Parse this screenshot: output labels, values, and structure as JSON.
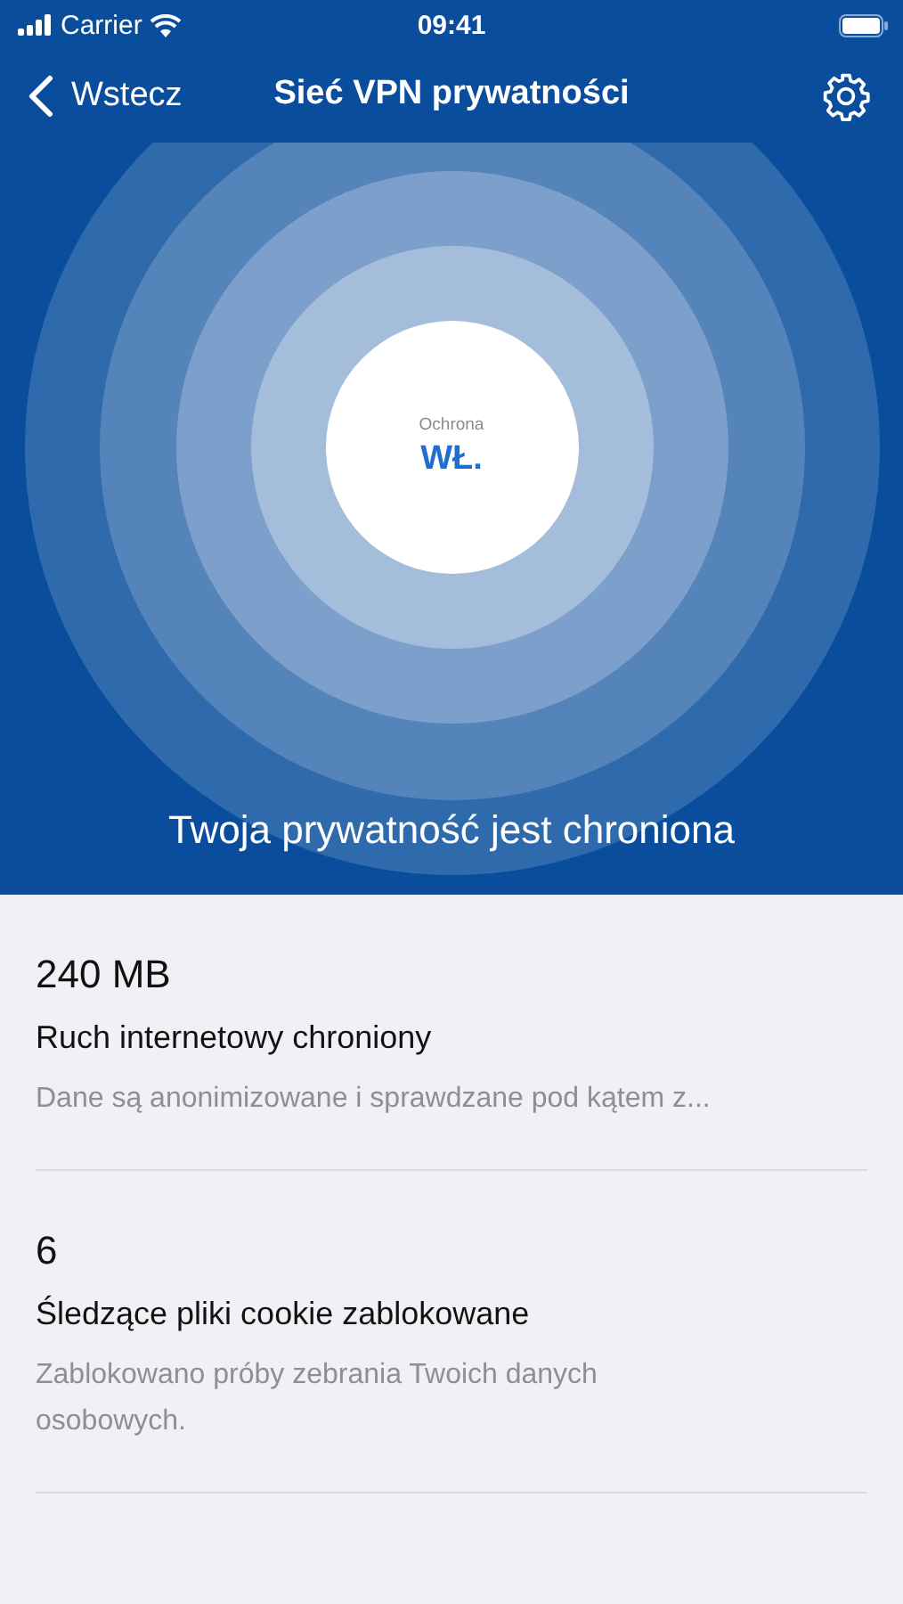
{
  "status_bar": {
    "carrier": "Carrier",
    "time": "09:41"
  },
  "nav": {
    "back": "Wstecz",
    "title": "Sieć VPN prywatności"
  },
  "protection": {
    "label": "Ochrona",
    "value": "WŁ.",
    "on": true,
    "caption": "Twoja prywatność jest chroniona"
  },
  "stats": [
    {
      "value": "240 MB",
      "title": "Ruch internetowy chroniony",
      "description": "Dane są anonimizowane i sprawdzane pod kątem z..."
    },
    {
      "value": "6",
      "title": "Śledzące pliki cookie zablokowane",
      "description": "Zablokowano próby zebrania Twoich danych osobowych."
    }
  ]
}
